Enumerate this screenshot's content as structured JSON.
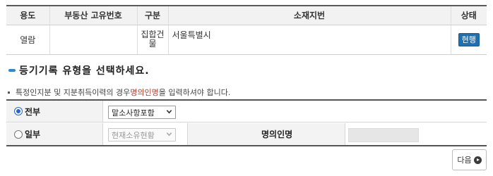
{
  "property_table": {
    "headers": {
      "use": "용도",
      "property_id": "부동산 고유번호",
      "type": "구분",
      "address": "소재지번",
      "status": "상태"
    },
    "row": {
      "use": "열람",
      "property_id": "",
      "type": "집합건물",
      "address": "서울특별시",
      "status": "현행"
    }
  },
  "section": {
    "title": "등기기록 유형을 선택하세요."
  },
  "note": {
    "before": "특정인지분 및 지분취득이력의 경우 ",
    "highlight": "명의인명",
    "after": "을 입력하셔야 합니다."
  },
  "options": {
    "all": {
      "label": "전부",
      "checked": true,
      "select_value": "말소사항포함"
    },
    "partial": {
      "label": "일부",
      "checked": false,
      "select_value": "현재소유현황",
      "name_label": "명의인명",
      "name_value": ""
    }
  },
  "buttons": {
    "next": "다음"
  },
  "colors": {
    "accent_blue": "#1f6fb3",
    "note_highlight": "#b23a2a",
    "header_bg": "#f2f2f2"
  }
}
